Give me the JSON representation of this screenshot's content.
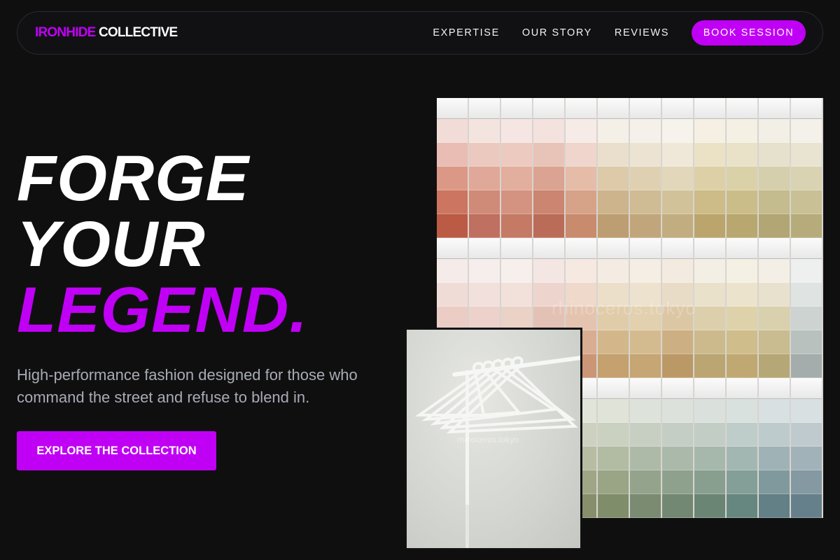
{
  "nav": {
    "brand_accent": "IRONHIDE",
    "brand_rest": " COLLECTIVE",
    "links": [
      "EXPERTISE",
      "OUR STORY",
      "REVIEWS"
    ],
    "cta": "BOOK SESSION"
  },
  "hero": {
    "headline_1": "FORGE",
    "headline_2": "YOUR",
    "headline_3": "LEGEND.",
    "subcopy": "High-performance fashion designed for those who command the street and refuse to blend in.",
    "cta": "EXPLORE THE COLLECTION"
  },
  "images": {
    "swatch_watermark": "rhinoceros.tokyo",
    "hanger_watermark": "rhinoceros.tokyo"
  },
  "colors": {
    "accent": "#c000f5",
    "background": "#0f0f10",
    "subcopy": "#a9abb5"
  },
  "swatch_palettes": {
    "row1": [
      [
        "#f2dcd8",
        "#e9bdb3",
        "#dc9886",
        "#cc7560",
        "#bb5b45"
      ],
      [
        "#f4e4e0",
        "#ecc9bf",
        "#e0a898",
        "#d08a78",
        "#c07060"
      ],
      [
        "#f5e6e3",
        "#eccabf",
        "#e2ae9d",
        "#d49380",
        "#c57a66"
      ],
      [
        "#f4e2de",
        "#e8c3b8",
        "#dba392",
        "#cb8570",
        "#bb6c58"
      ],
      [
        "#f6ebe6",
        "#efd5cb",
        "#e4bca8",
        "#d6a288",
        "#c88b6e"
      ],
      [
        "#f4efe7",
        "#eadfcc",
        "#dccaa9",
        "#cdb48c",
        "#bd9e72"
      ],
      [
        "#f5f1ea",
        "#ece3d2",
        "#dfd0b2",
        "#cfbb94",
        "#c0a67a"
      ],
      [
        "#f6f3ec",
        "#efe8d8",
        "#e2d7ba",
        "#d2c29a",
        "#c1ad80"
      ],
      [
        "#f5f0e3",
        "#ebe2c6",
        "#ddd0a6",
        "#cdbb88",
        "#bba56d"
      ],
      [
        "#f4f0e4",
        "#e9e2c8",
        "#dbd1a8",
        "#cbbd8a",
        "#b9a770"
      ],
      [
        "#f2efe6",
        "#e6e1cc",
        "#d6cfad",
        "#c4bb8e",
        "#b1a674"
      ],
      [
        "#f3f1e9",
        "#e8e4d1",
        "#dad3b3",
        "#c9c096",
        "#b6ab7b"
      ]
    ],
    "row2": [
      [
        "#f5ebe9",
        "#f0dcd7",
        "#ebcdc6",
        "#e4bcb2",
        "#dcaa9e"
      ],
      [
        "#f6eeec",
        "#f1e0db",
        "#ecd2cb",
        "#e5c2b8",
        "#ddb1a5"
      ],
      [
        "#f7efec",
        "#f1e1da",
        "#ead2c6",
        "#e2c0b0",
        "#d9ad9a"
      ],
      [
        "#f4e6e3",
        "#edd5cd",
        "#e4c1b5",
        "#d9ab9b",
        "#cd9582"
      ],
      [
        "#f5e9e2",
        "#eed9cb",
        "#e4c4ae",
        "#d8ad91",
        "#cb9676"
      ],
      [
        "#f4ece2",
        "#ecdfca",
        "#e1ccaa",
        "#d3b78b",
        "#c4a16f"
      ],
      [
        "#f5eee4",
        "#ede2cd",
        "#e2d0ae",
        "#d4bb8f",
        "#c5a674"
      ],
      [
        "#f3ebe0",
        "#e9dcc6",
        "#dcc7a4",
        "#ccb083",
        "#bb9967"
      ],
      [
        "#f4efe4",
        "#eae1ca",
        "#dccfab",
        "#ccba8d",
        "#bba573"
      ],
      [
        "#f5f0e4",
        "#ebe3cb",
        "#ded2ab",
        "#cfbd8c",
        "#bfa872"
      ],
      [
        "#f3efe6",
        "#e8e1cd",
        "#d9d0ae",
        "#c8bc90",
        "#b6a776"
      ],
      [
        "#eef0ef",
        "#dfe3e2",
        "#cdd3d1",
        "#b9c1bf",
        "#a4adab"
      ]
    ],
    "row3": [
      [
        "#d6dadb",
        "#c2c8ca",
        "#adb5b7",
        "#97a0a3",
        "#82898c"
      ],
      [
        "#dfe3dc",
        "#ccd2c6",
        "#b6bdaa",
        "#9fa68e",
        "#878e74"
      ],
      [
        "#e2e5da",
        "#d0d5c3",
        "#bbc2a7",
        "#a4ab8b",
        "#8c9371"
      ],
      [
        "#e4e6dc",
        "#d2d6c6",
        "#bdc3aa",
        "#a6ad8e",
        "#8e9574"
      ],
      [
        "#e1e4d8",
        "#cdd2c0",
        "#b6bda3",
        "#9ea686",
        "#868e6c"
      ],
      [
        "#dfe3d8",
        "#cad1c0",
        "#b2bca2",
        "#99a585",
        "#808d6b"
      ],
      [
        "#dde2da",
        "#c7cfc3",
        "#aebaa8",
        "#94a38b",
        "#7a8b71"
      ],
      [
        "#dce2db",
        "#c5cec4",
        "#abb9aa",
        "#8ea18d",
        "#738873"
      ],
      [
        "#dae1dc",
        "#c2cdc6",
        "#a6b8ac",
        "#889f90",
        "#6b8575"
      ],
      [
        "#d9e1df",
        "#bfcdca",
        "#a2b7b2",
        "#849f98",
        "#66877f"
      ],
      [
        "#d8e0e1",
        "#bdcbcd",
        "#9fb3b6",
        "#80999d",
        "#628085"
      ],
      [
        "#d9e0e2",
        "#bfcacf",
        "#a2b2b9",
        "#8499a2",
        "#66808b"
      ]
    ]
  }
}
